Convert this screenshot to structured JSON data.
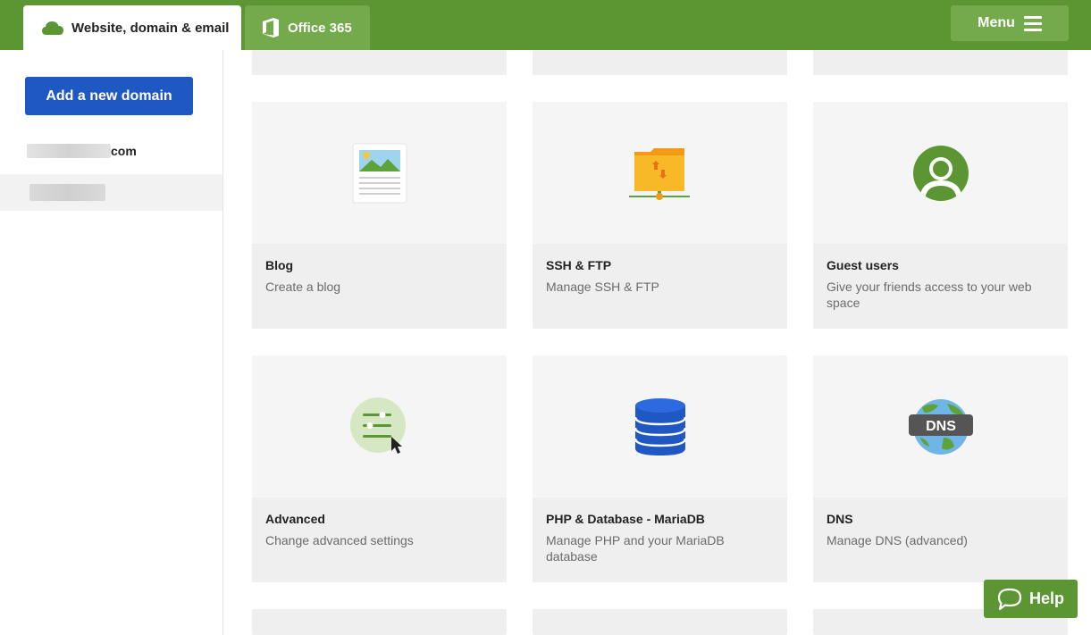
{
  "tabs": [
    {
      "label": "Website, domain & email",
      "icon": "cloud-icon",
      "active": true
    },
    {
      "label": "Office 365",
      "icon": "office-icon",
      "active": false
    }
  ],
  "menu": {
    "label": "Menu",
    "icon": "hamburger-icon"
  },
  "sidebar": {
    "add_domain_label": "Add a new domain",
    "domains": [
      {
        "suffix": "com"
      },
      {
        "suffix": ""
      }
    ]
  },
  "cards": [
    {
      "title": "Blog",
      "description": "Create a blog",
      "icon": "blog-document-icon"
    },
    {
      "title": "SSH & FTP",
      "description": "Manage SSH & FTP",
      "icon": "ftp-folder-icon"
    },
    {
      "title": "Guest users",
      "description": "Give your friends access to your web space",
      "icon": "guest-user-icon"
    },
    {
      "title": "Advanced",
      "description": "Change advanced settings",
      "icon": "advanced-settings-icon"
    },
    {
      "title": "PHP & Database - MariaDB",
      "description": "Manage PHP and your MariaDB database",
      "icon": "database-icon"
    },
    {
      "title": "DNS",
      "description": "Manage DNS (advanced)",
      "icon": "dns-globe-icon",
      "badge": "DNS"
    }
  ],
  "help": {
    "label": "Help",
    "icon": "chat-bubble-icon"
  },
  "colors": {
    "brand_green": "#5c9632",
    "button_blue": "#1f57c3"
  }
}
